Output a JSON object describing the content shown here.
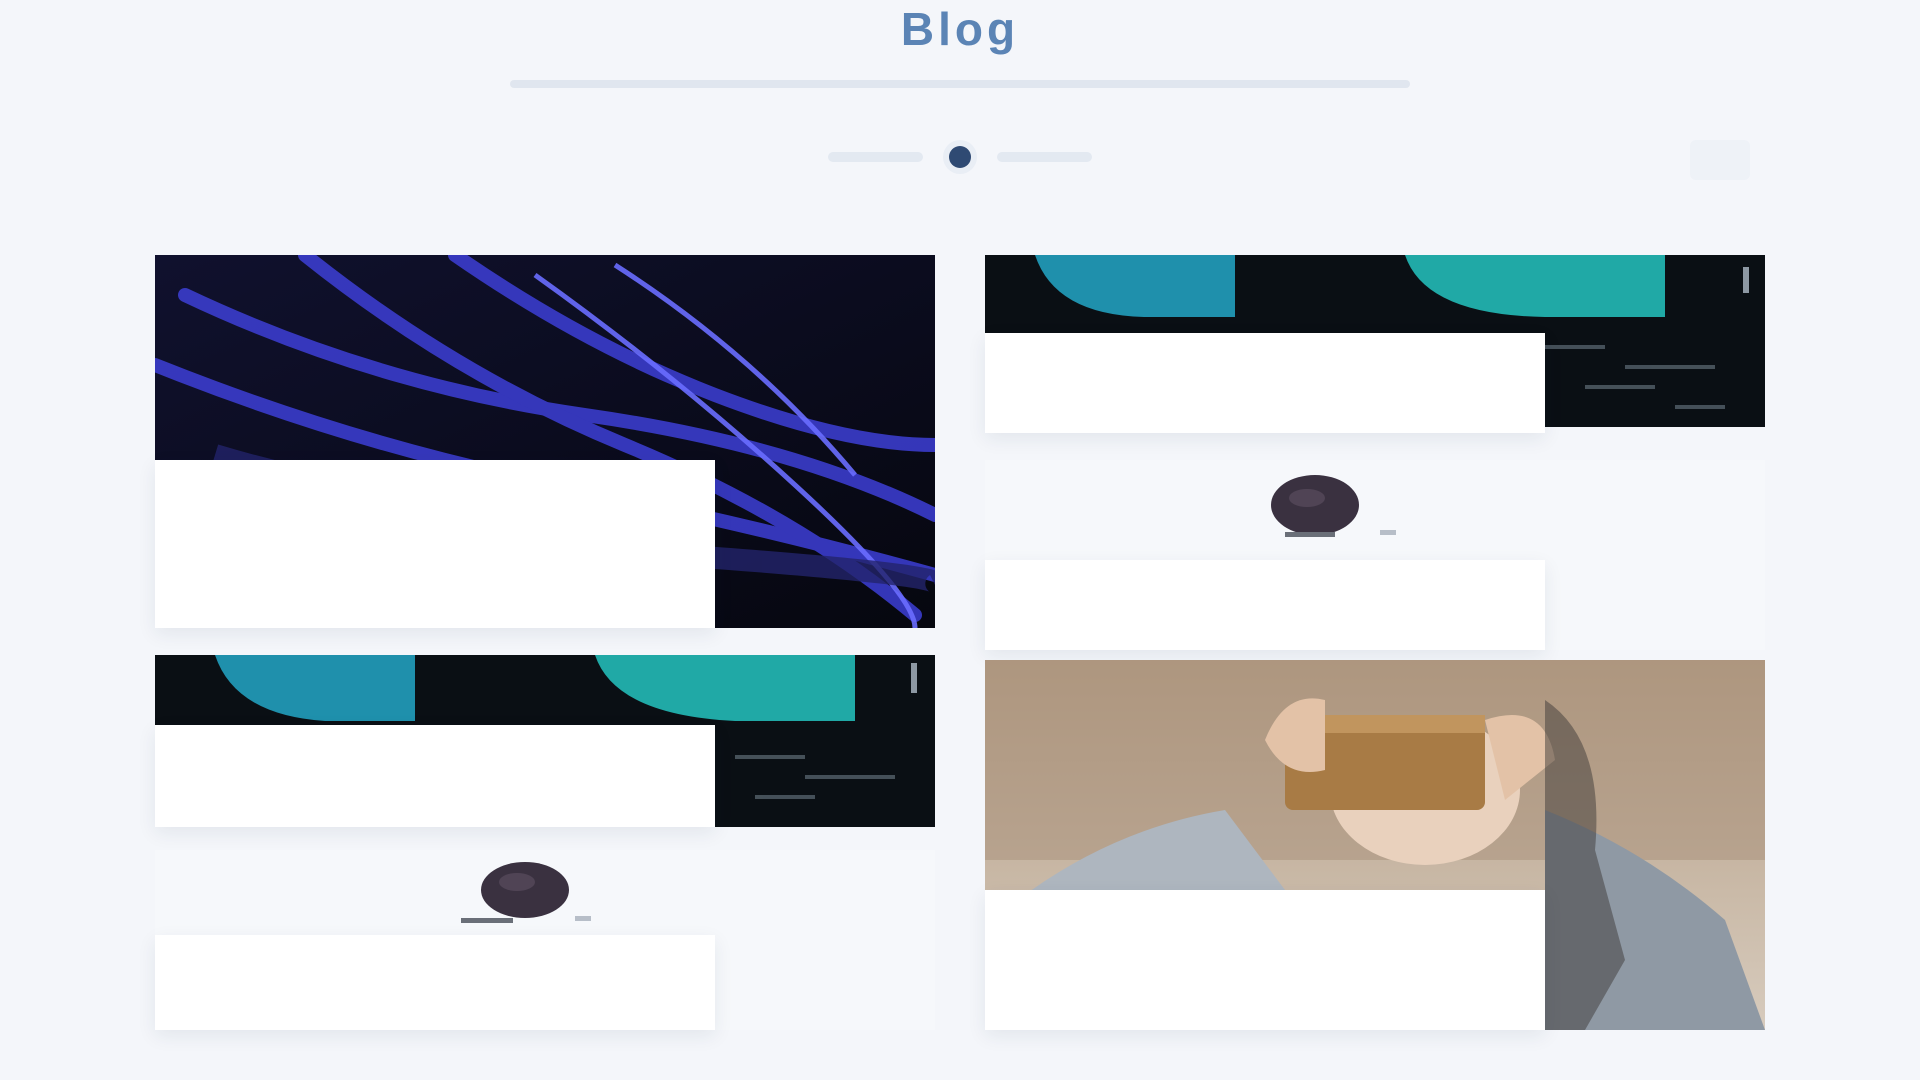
{
  "header": {
    "title": "Blog",
    "subtitle": ""
  },
  "colors": {
    "title": "#5b84b5",
    "accent": "#4f89c9",
    "pager_active": "#2f4a73",
    "card_panel": "#ffffff",
    "page_bg": "#f4f6fa"
  },
  "pager": {
    "active_index": 0
  },
  "posts": [
    {
      "title": "",
      "excerpt": "",
      "image": "blue-neon-network-lines"
    },
    {
      "title": "",
      "excerpt": "",
      "image": "dark-data-chart-cyan"
    },
    {
      "title": "",
      "excerpt": "",
      "image": "dark-data-chart-cyan"
    },
    {
      "title": "",
      "excerpt": "",
      "image": "dark-round-device"
    },
    {
      "title": "",
      "excerpt": "",
      "image": "dark-round-device"
    },
    {
      "title": "",
      "excerpt": "",
      "image": "person-with-cardboard-vr-headset"
    }
  ]
}
